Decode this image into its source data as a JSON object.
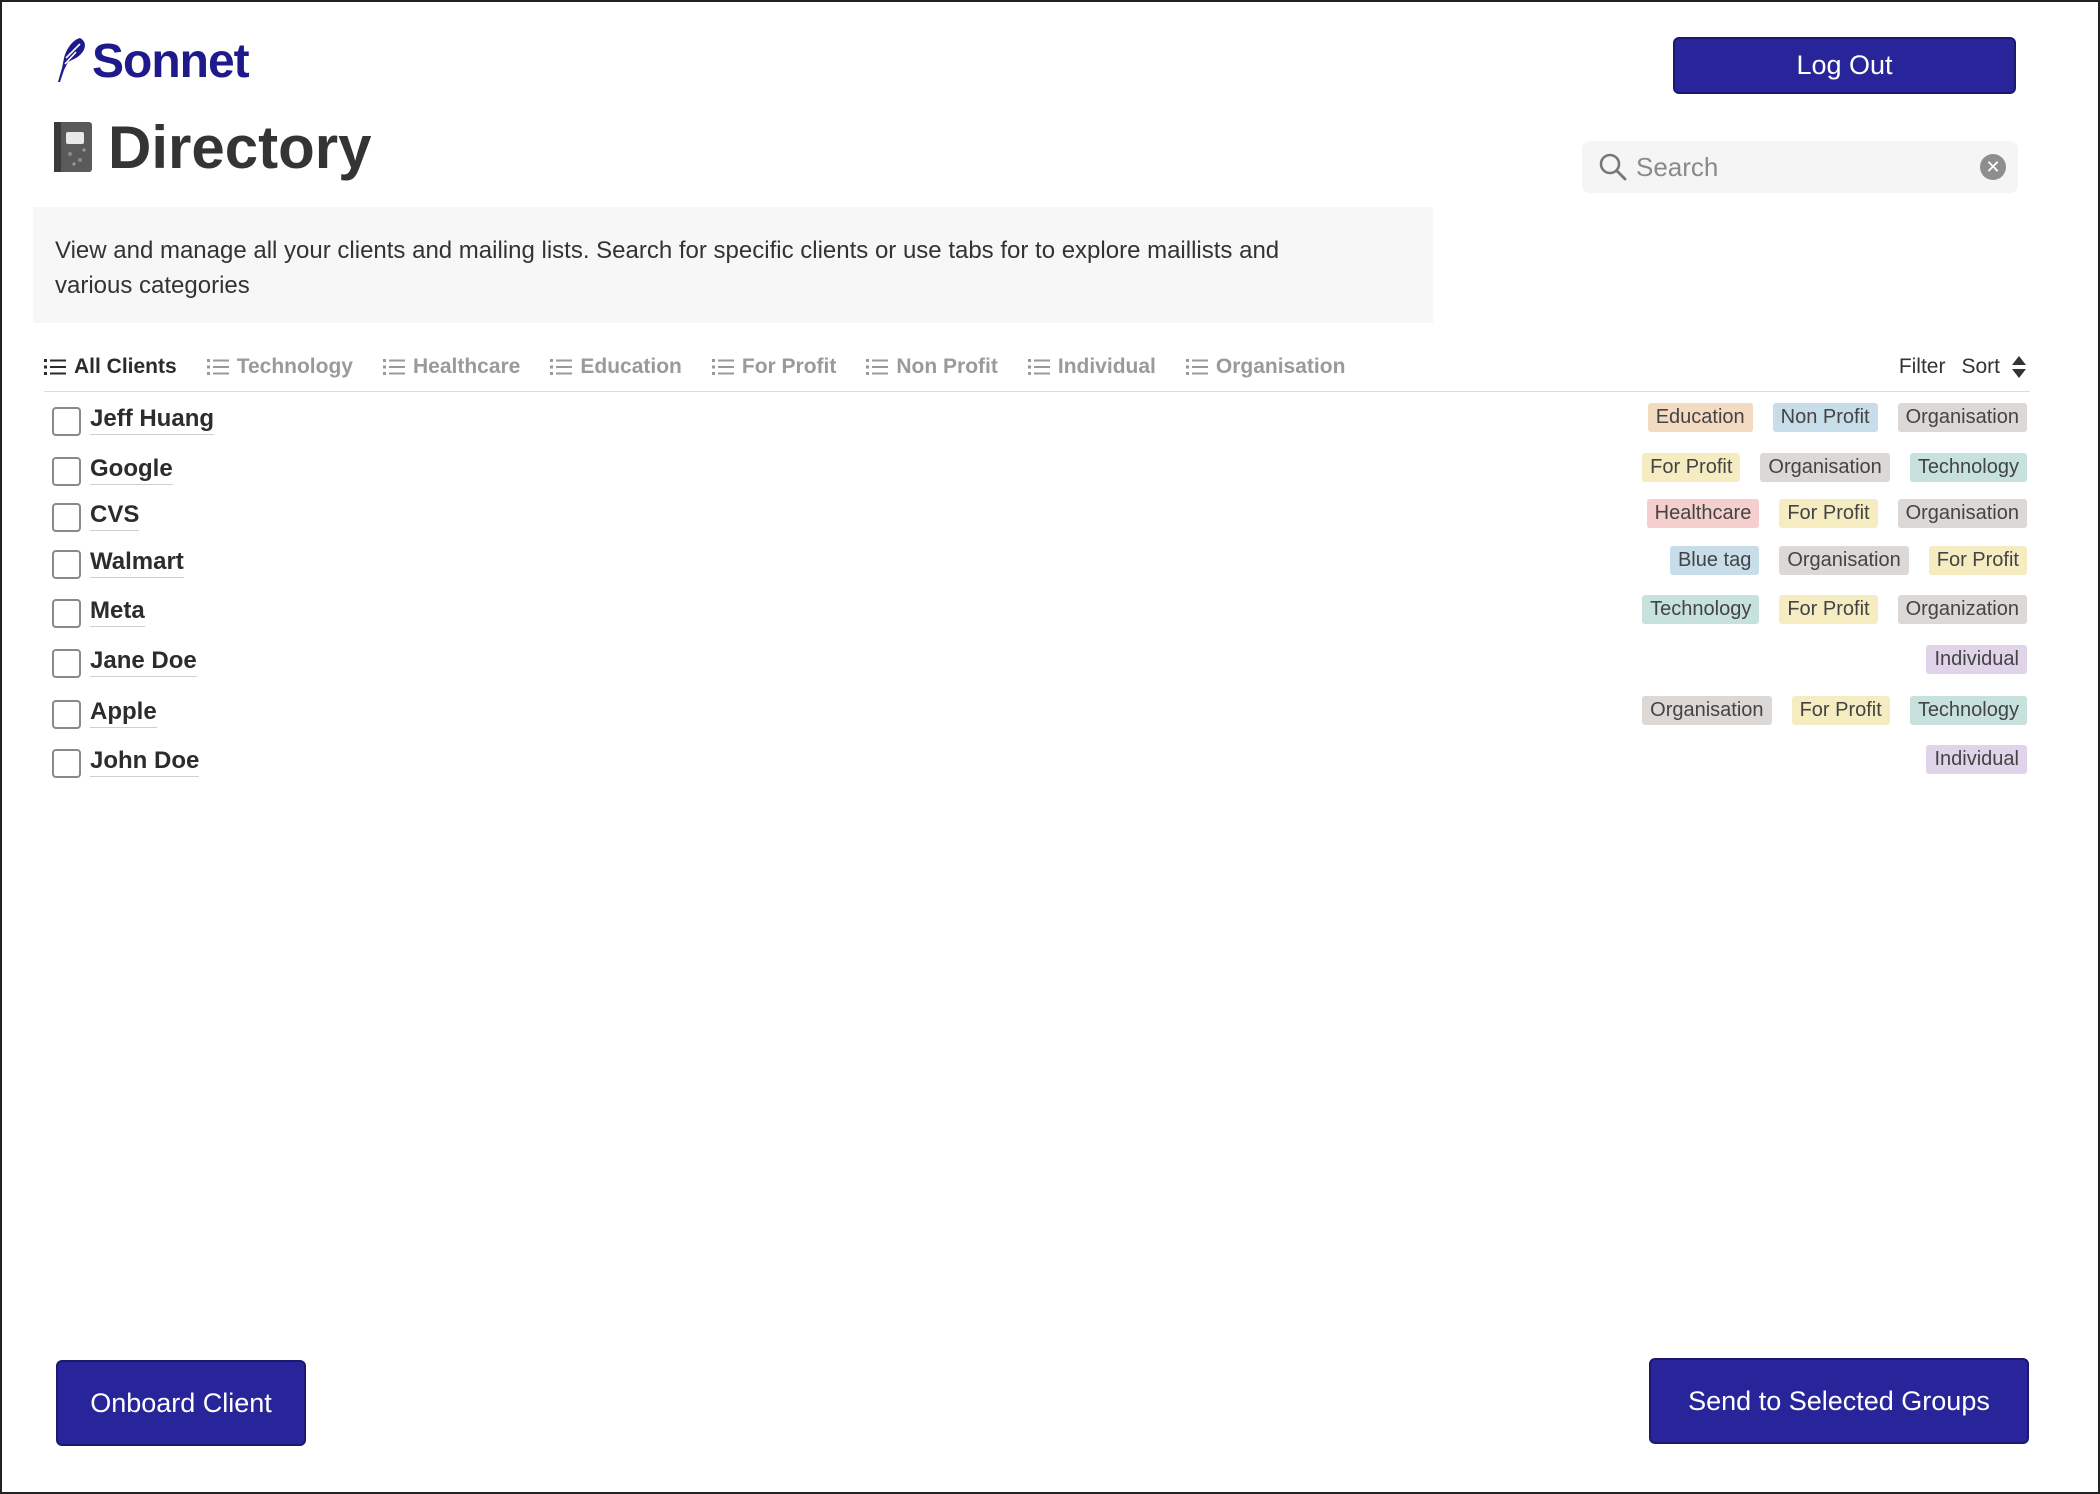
{
  "app": {
    "logo_text": "Sonnet",
    "page_title": "Directory",
    "description": "View and manage all your clients and mailing lists.  Search for specific  clients or use tabs for to explore maillists and various categories"
  },
  "header": {
    "logout_label": "Log Out",
    "search": {
      "placeholder": "Search",
      "value": ""
    }
  },
  "tabs": [
    {
      "label": "All Clients",
      "active": true
    },
    {
      "label": "Technology",
      "active": false
    },
    {
      "label": "Healthcare",
      "active": false
    },
    {
      "label": "Education",
      "active": false
    },
    {
      "label": "For Profit",
      "active": false
    },
    {
      "label": "Non Profit",
      "active": false
    },
    {
      "label": "Individual",
      "active": false
    },
    {
      "label": "Organisation",
      "active": false
    }
  ],
  "tools": {
    "filter_label": "Filter",
    "sort_label": "Sort"
  },
  "clients": [
    {
      "name": "Jeff Huang",
      "tags": [
        {
          "label": "Education",
          "color": "#f3dbc1"
        },
        {
          "label": "Non Profit",
          "color": "#c7dde9"
        },
        {
          "label": "Organisation",
          "color": "#dcd8d6"
        }
      ]
    },
    {
      "name": "Google",
      "tags": [
        {
          "label": "For Profit",
          "color": "#f6ecc2"
        },
        {
          "label": "Organisation",
          "color": "#dcd8d6"
        },
        {
          "label": "Technology",
          "color": "#c7e1dc"
        }
      ]
    },
    {
      "name": "CVS",
      "tags": [
        {
          "label": "Healthcare",
          "color": "#f4cfcd"
        },
        {
          "label": "For Profit",
          "color": "#f6ecc2"
        },
        {
          "label": "Organisation",
          "color": "#dcd8d6"
        }
      ]
    },
    {
      "name": "Walmart",
      "tags": [
        {
          "label": "Blue tag",
          "color": "#c7dde9"
        },
        {
          "label": "Organisation",
          "color": "#dcd8d6"
        },
        {
          "label": "For Profit",
          "color": "#f6ecc2"
        }
      ]
    },
    {
      "name": "Meta",
      "tags": [
        {
          "label": "Technology",
          "color": "#c7e1dc"
        },
        {
          "label": "For Profit",
          "color": "#f6ecc2"
        },
        {
          "label": "Organization",
          "color": "#dcd8d6"
        }
      ]
    },
    {
      "name": "Jane Doe",
      "tags": [
        {
          "label": "Individual",
          "color": "#e0d3ea"
        }
      ]
    },
    {
      "name": "Apple",
      "tags": [
        {
          "label": "Organisation",
          "color": "#dcd8d6"
        },
        {
          "label": "For Profit",
          "color": "#f6ecc2"
        },
        {
          "label": "Technology",
          "color": "#c7e1dc"
        }
      ]
    },
    {
      "name": "John Doe",
      "tags": [
        {
          "label": "Individual",
          "color": "#e0d3ea"
        }
      ]
    }
  ],
  "footer": {
    "onboard_label": "Onboard Client",
    "send_label": "Send to Selected Groups"
  },
  "colors": {
    "primary": "#28249a",
    "brand": "#1e1a8c"
  }
}
